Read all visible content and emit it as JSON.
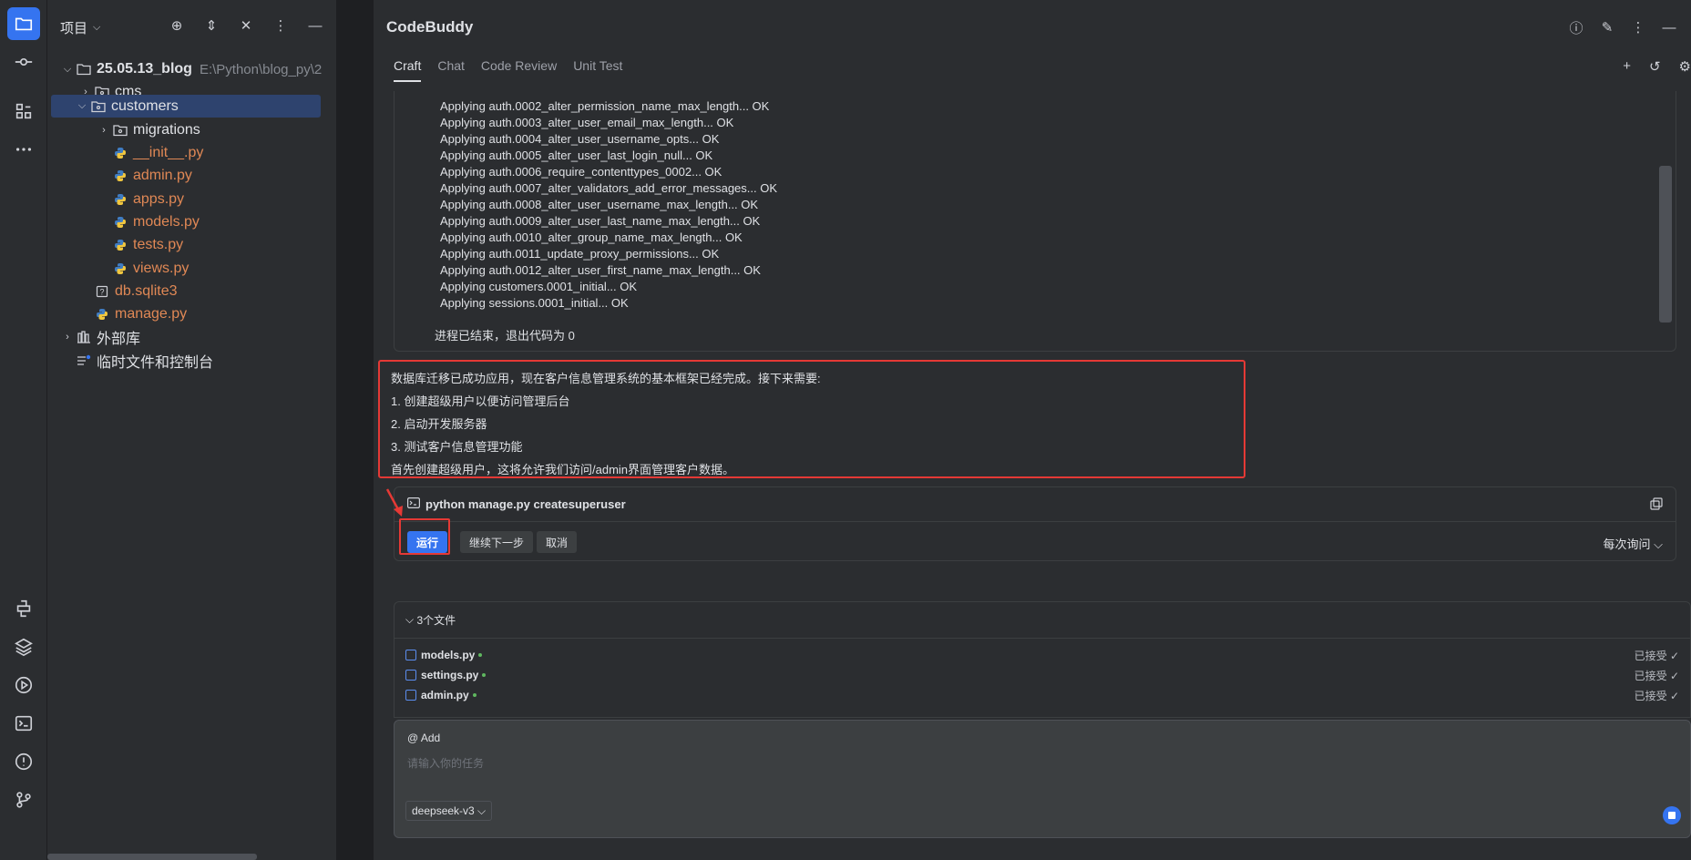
{
  "activity_bar": {
    "top_icons": [
      "folder-icon",
      "commit-icon",
      "structure-icon",
      "more-icon"
    ],
    "bottom_icons": [
      "python-icon",
      "layers-icon",
      "run-icon",
      "terminal-icon",
      "problems-icon",
      "git-icon"
    ]
  },
  "project_panel": {
    "title": "项目",
    "tree": [
      {
        "label": "25.05.13_blog",
        "path": "E:\\Python\\blog_py\\2",
        "type": "folder",
        "expanded": true
      },
      {
        "label": "cms",
        "type": "folder",
        "expanded": false
      },
      {
        "label": "customers",
        "type": "folder",
        "expanded": true,
        "selected": true
      },
      {
        "label": "migrations",
        "type": "folder",
        "expanded": false
      },
      {
        "label": "__init__.py",
        "type": "python"
      },
      {
        "label": "admin.py",
        "type": "python"
      },
      {
        "label": "apps.py",
        "type": "python"
      },
      {
        "label": "models.py",
        "type": "python"
      },
      {
        "label": "tests.py",
        "type": "python"
      },
      {
        "label": "views.py",
        "type": "python"
      },
      {
        "label": "db.sqlite3",
        "type": "unknown"
      },
      {
        "label": "manage.py",
        "type": "python"
      },
      {
        "label": "外部库",
        "type": "library"
      },
      {
        "label": "临时文件和控制台",
        "type": "scratch"
      }
    ]
  },
  "main": {
    "title": "CodeBuddy",
    "tabs": [
      "Craft",
      "Chat",
      "Code Review",
      "Unit Test"
    ],
    "active_tab": "Craft",
    "output_lines": [
      "Applying auth.0002_alter_permission_name_max_length... OK",
      "Applying auth.0003_alter_user_email_max_length... OK",
      "Applying auth.0004_alter_user_username_opts... OK",
      "Applying auth.0005_alter_user_last_login_null... OK",
      "Applying auth.0006_require_contenttypes_0002... OK",
      "Applying auth.0007_alter_validators_add_error_messages... OK",
      "Applying auth.0008_alter_user_username_max_length... OK",
      "Applying auth.0009_alter_user_last_name_max_length... OK",
      "Applying auth.0010_alter_group_name_max_length... OK",
      "Applying auth.0011_update_proxy_permissions... OK",
      "Applying auth.0012_alter_user_first_name_max_length... OK",
      "Applying customers.0001_initial... OK",
      "Applying sessions.0001_initial... OK"
    ],
    "output_exit": "进程已结束，退出代码为 0",
    "message_lines": [
      "数据库迁移已成功应用，现在客户信息管理系统的基本框架已经完成。接下来需要:",
      "1. 创建超级用户以便访问管理后台",
      "2. 启动开发服务器",
      "3. 测试客户信息管理功能",
      "首先创建超级用户，这将允许我们访问/admin界面管理客户数据。"
    ],
    "command": {
      "text": "python manage.py createsuperuser",
      "run_label": "运行",
      "next_label": "继续下一步",
      "cancel_label": "取消",
      "mode_label": "每次询问"
    },
    "files": {
      "header": "3个文件",
      "items": [
        {
          "name": "models.py",
          "status": "已接受"
        },
        {
          "name": "settings.py",
          "status": "已接受"
        },
        {
          "name": "admin.py",
          "status": "已接受"
        }
      ]
    },
    "input": {
      "at_add": "@ Add",
      "placeholder": "请输入你的任务",
      "model": "deepseek-v3"
    }
  },
  "colors": {
    "accent": "#3574f0",
    "highlight": "#e53935",
    "python_file": "#e08855",
    "selection": "#2e436e"
  }
}
